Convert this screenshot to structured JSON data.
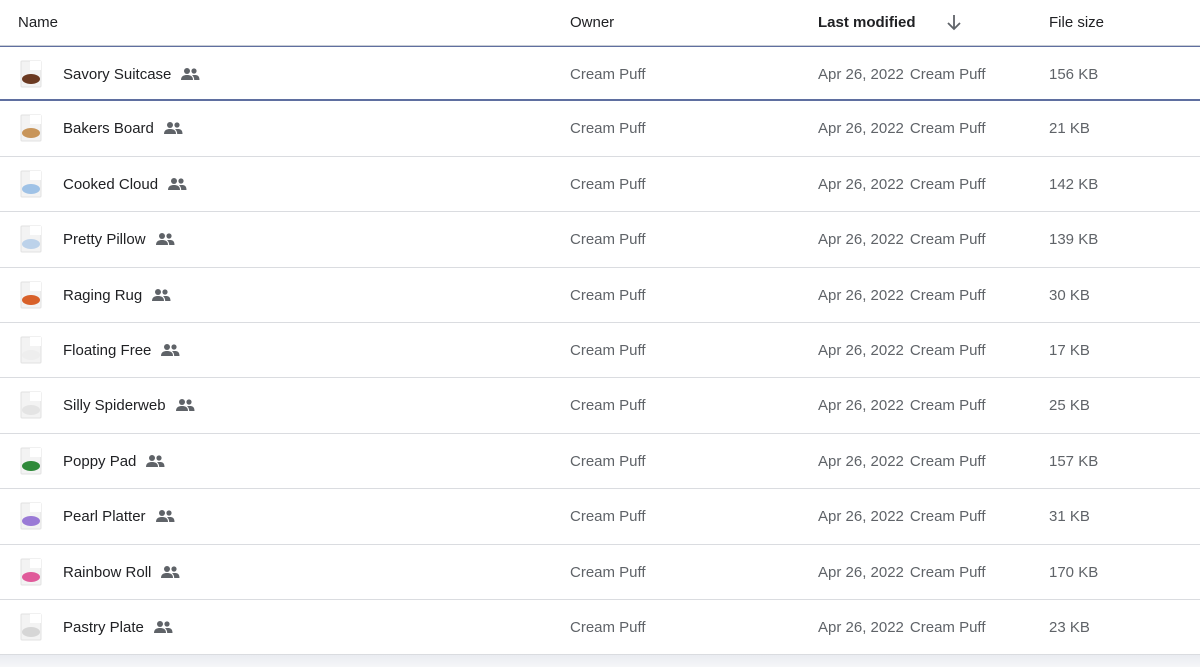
{
  "header": {
    "name": "Name",
    "owner": "Owner",
    "last_modified": "Last modified",
    "sort_icon": "arrow-down-icon",
    "file_size": "File size"
  },
  "rows": [
    {
      "name": "Savory Suitcase",
      "owner": "Cream Puff",
      "date": "Apr 26, 2022",
      "modified_by": "Cream Puff",
      "size": "156 KB",
      "thumb_color": "#6b3a22",
      "selected": true
    },
    {
      "name": "Bakers Board",
      "owner": "Cream Puff",
      "date": "Apr 26, 2022",
      "modified_by": "Cream Puff",
      "size": "21 KB",
      "thumb_color": "#c8955a"
    },
    {
      "name": "Cooked Cloud",
      "owner": "Cream Puff",
      "date": "Apr 26, 2022",
      "modified_by": "Cream Puff",
      "size": "142 KB",
      "thumb_color": "#9fc2e6"
    },
    {
      "name": "Pretty Pillow",
      "owner": "Cream Puff",
      "date": "Apr 26, 2022",
      "modified_by": "Cream Puff",
      "size": "139 KB",
      "thumb_color": "#bcd2ea"
    },
    {
      "name": "Raging Rug",
      "owner": "Cream Puff",
      "date": "Apr 26, 2022",
      "modified_by": "Cream Puff",
      "size": "30 KB",
      "thumb_color": "#d8612a"
    },
    {
      "name": "Floating Free",
      "owner": "Cream Puff",
      "date": "Apr 26, 2022",
      "modified_by": "Cream Puff",
      "size": "17 KB",
      "thumb_color": "#eeeeee"
    },
    {
      "name": "Silly Spiderweb",
      "owner": "Cream Puff",
      "date": "Apr 26, 2022",
      "modified_by": "Cream Puff",
      "size": "25 KB",
      "thumb_color": "#e4e4e4"
    },
    {
      "name": "Poppy Pad",
      "owner": "Cream Puff",
      "date": "Apr 26, 2022",
      "modified_by": "Cream Puff",
      "size": "157 KB",
      "thumb_color": "#2f8a3a"
    },
    {
      "name": "Pearl Platter",
      "owner": "Cream Puff",
      "date": "Apr 26, 2022",
      "modified_by": "Cream Puff",
      "size": "31 KB",
      "thumb_color": "#9a7ad6"
    },
    {
      "name": "Rainbow Roll",
      "owner": "Cream Puff",
      "date": "Apr 26, 2022",
      "modified_by": "Cream Puff",
      "size": "170 KB",
      "thumb_color": "#e05a9a"
    },
    {
      "name": "Pastry Plate",
      "owner": "Cream Puff",
      "date": "Apr 26, 2022",
      "modified_by": "Cream Puff",
      "size": "23 KB",
      "thumb_color": "#d6d6d6"
    }
  ],
  "icons": {
    "shared": "people-icon"
  }
}
